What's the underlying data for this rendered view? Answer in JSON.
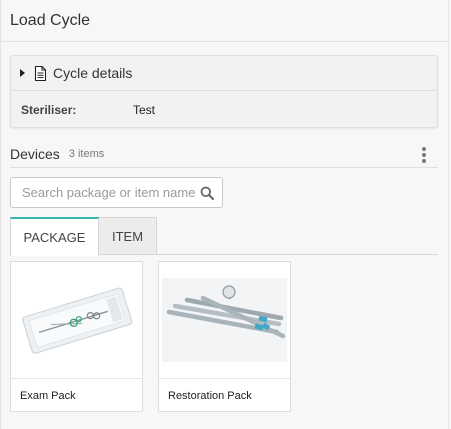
{
  "header": {
    "title": "Load Cycle"
  },
  "cycle_details": {
    "label": "Cycle details",
    "fields": [
      {
        "key": "Steriliser:",
        "value": "Test"
      }
    ]
  },
  "devices": {
    "title": "Devices",
    "count": "3 items"
  },
  "search": {
    "placeholder": "Search package or item name",
    "value": ""
  },
  "tabs": [
    {
      "label": "PACKAGE",
      "active": true
    },
    {
      "label": "ITEM",
      "active": false
    }
  ],
  "cards": [
    {
      "label": "Exam Pack"
    },
    {
      "label": "Restoration Pack"
    }
  ],
  "colors": {
    "tab_accent": "#35b7b1",
    "background": "#f7f7f7",
    "card_border": "#dcdcdc"
  },
  "icons": [
    "caret-right-icon",
    "document-icon",
    "kebab-menu-icon",
    "search-icon"
  ]
}
